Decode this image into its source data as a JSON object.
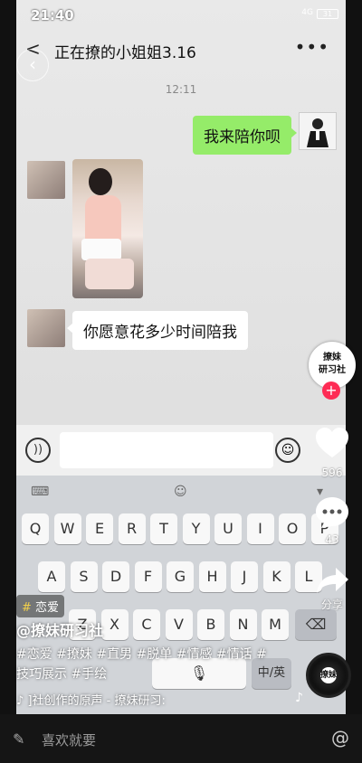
{
  "status": {
    "time": "21:40",
    "network": "4G",
    "battery": "31"
  },
  "chat": {
    "title": "正在撩的小姐姐3.16",
    "timestamp": "12:11",
    "msg_me": "我来陪你呗",
    "msg_her": "你愿意花多少时间陪我"
  },
  "keyboard": {
    "row1": [
      "Q",
      "W",
      "E",
      "R",
      "T",
      "Y",
      "U",
      "I",
      "O",
      "P"
    ],
    "row2": [
      "A",
      "S",
      "D",
      "F",
      "G",
      "H",
      "J",
      "K",
      "L"
    ],
    "row3": [
      "Z",
      "X",
      "C",
      "V",
      "B",
      "N",
      "M"
    ],
    "lang": "中/英"
  },
  "video": {
    "follow_label": "撩妹\n研习社",
    "likes": "596",
    "comments": "43",
    "share": "分享",
    "tag_symbol": "#",
    "tag": "恋爱",
    "author": "@撩妹研习社",
    "desc": "#恋爱 #撩妹 #直男 #脱单 #情感 #情话 #技巧展示 #手绘",
    "music": "]社创作的原声 - 撩妹研习:",
    "record_label": "撩妹"
  },
  "comment_bar": {
    "placeholder": "喜欢就要"
  },
  "icons": [
    "back-icon",
    "more-icon",
    "voice-icon",
    "emoji-icon",
    "heart-icon",
    "comment-icon",
    "share-icon",
    "music-note-icon",
    "at-icon",
    "pencil-icon",
    "plus-icon"
  ]
}
